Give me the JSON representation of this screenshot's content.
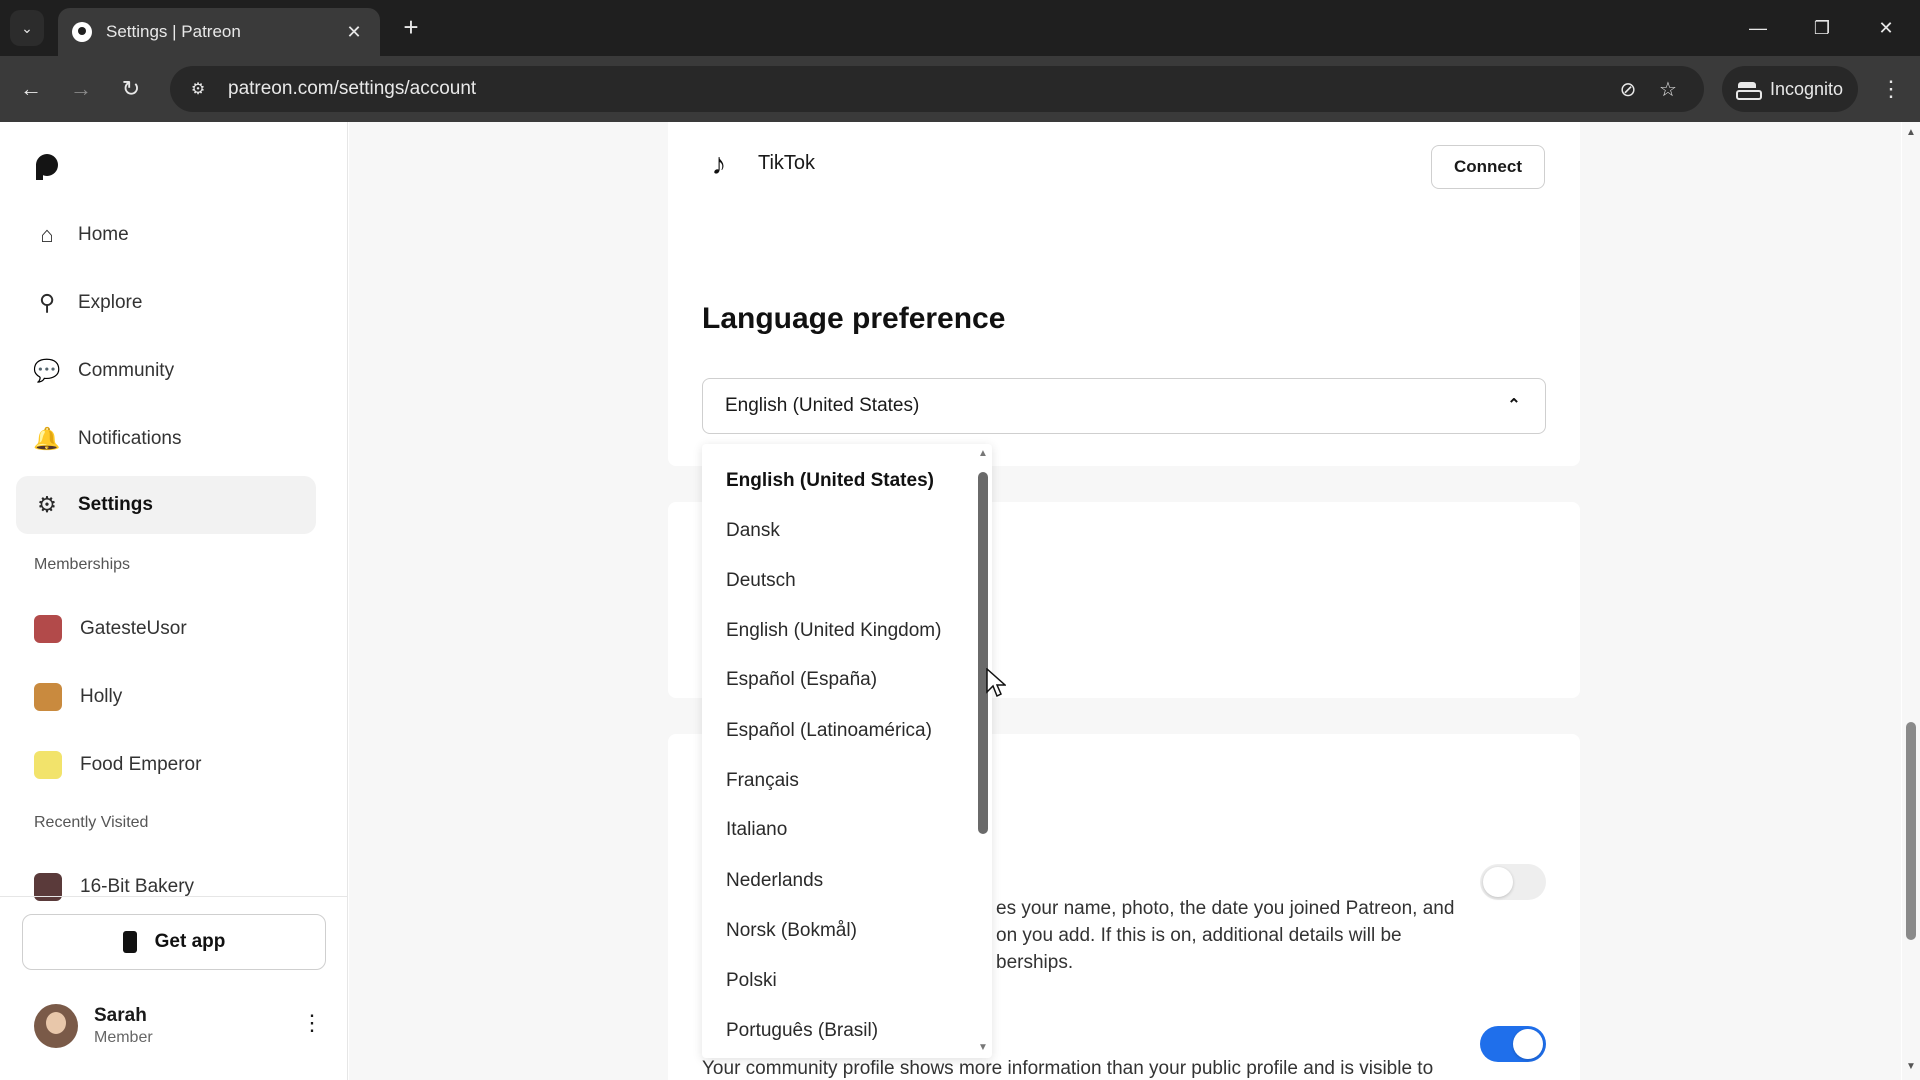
{
  "browser": {
    "tab_title": "Settings | Patreon",
    "url": "patreon.com/settings/account",
    "incognito_label": "Incognito"
  },
  "sidebar": {
    "nav": [
      {
        "label": "Home",
        "icon": "home-icon"
      },
      {
        "label": "Explore",
        "icon": "search-icon"
      },
      {
        "label": "Community",
        "icon": "chat-icon"
      },
      {
        "label": "Notifications",
        "icon": "bell-icon"
      },
      {
        "label": "Settings",
        "icon": "gear-icon",
        "active": true
      }
    ],
    "memberships_label": "Memberships",
    "memberships": [
      {
        "label": "GatesteUsor"
      },
      {
        "label": "Holly"
      },
      {
        "label": "Food Emperor"
      }
    ],
    "recently_visited_label": "Recently Visited",
    "recent": [
      {
        "label": "16-Bit Bakery"
      }
    ],
    "get_app_label": "Get app",
    "user": {
      "name": "Sarah",
      "role": "Member"
    }
  },
  "main": {
    "tiktok_label": "TikTok",
    "connect_label": "Connect",
    "language_heading": "Language preference",
    "language_selected": "English (United States)",
    "language_options": [
      "English (United States)",
      "Dansk",
      "Deutsch",
      "English (United Kingdom)",
      "Español (España)",
      "Español (Latinoamérica)",
      "Français",
      "Italiano",
      "Nederlands",
      "Norsk (Bokmål)",
      "Polski",
      "Português (Brasil)"
    ],
    "public_profile_text_line1": "es your name, photo, the date you joined Patreon, and",
    "public_profile_text_line2": "on you add. If this is on, additional details will be",
    "public_profile_text_line3": "berships.",
    "community_profile_text": "Your community profile shows more information than your public profile and is visible to",
    "public_profile_toggle_on": false,
    "community_profile_toggle_on": true
  },
  "colors": {
    "toggle_on": "#1f6feb",
    "chrome_dark": "#1f1f1f"
  }
}
